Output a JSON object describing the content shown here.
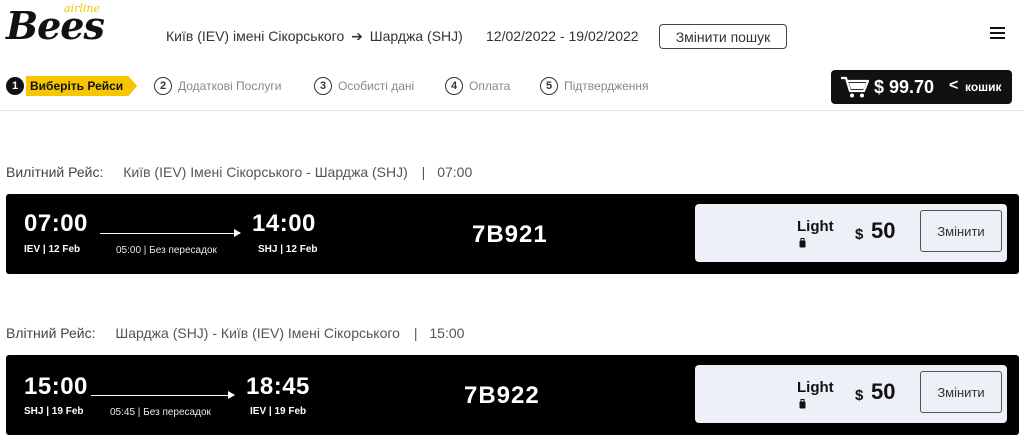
{
  "header": {
    "logo_text": "Bees",
    "logo_sub": "airline",
    "route_from": "Київ (IEV) імені Сікорського",
    "route_arrow": "➔",
    "route_to": "Шарджа (SHJ)",
    "dates": "12/02/2022 - 19/02/2022",
    "change_search_label": "Змінити пошук"
  },
  "steps": [
    {
      "num": "1",
      "label": "Виберіть Рейси"
    },
    {
      "num": "2",
      "label": "Додаткові Послуги"
    },
    {
      "num": "3",
      "label": "Особисті дані"
    },
    {
      "num": "4",
      "label": "Оплата"
    },
    {
      "num": "5",
      "label": "Підтвердження"
    }
  ],
  "cart": {
    "total": "$ 99.70",
    "chevron": "<",
    "label": "кошик",
    "icon": "cart-icon"
  },
  "flights": [
    {
      "kind": "Вилітний Рейс:",
      "route": "Київ (IEV) Імені Сікорського - Шарджа (SHJ)",
      "sep": "|",
      "time": "07:00",
      "dep_time": "07:00",
      "dep_sub": "IEV | 12 Feb",
      "duration": "05:00 | Без пересадок",
      "arr_time": "14:00",
      "arr_sub": "SHJ | 12 Feb",
      "flight_no": "7B921",
      "fare_name": "Light",
      "currency": "$",
      "price": "50",
      "change_label": "Змінити"
    },
    {
      "kind": "Влітний Рейс:",
      "route": "Шарджа (SHJ) - Київ (IEV) Імені Сікорського",
      "sep": "|",
      "time": "15:00",
      "dep_time": "15:00",
      "dep_sub": "SHJ | 19 Feb",
      "duration": "05:45 | Без пересадок",
      "arr_time": "18:45",
      "arr_sub": "IEV | 19 Feb",
      "flight_no": "7B922",
      "fare_name": "Light",
      "currency": "$",
      "price": "50",
      "change_label": "Змінити"
    }
  ],
  "colors": {
    "accent": "#f7c600",
    "card_bg": "#000000",
    "fare_bg": "#eef0f8"
  }
}
